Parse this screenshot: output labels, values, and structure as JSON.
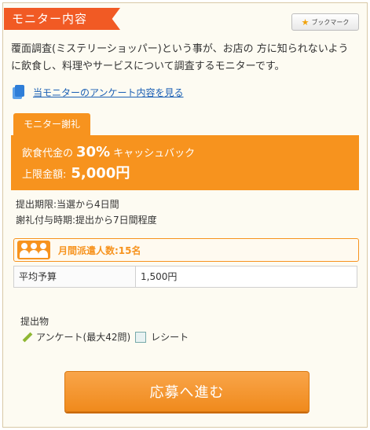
{
  "header": {
    "title": "モニター内容",
    "bookmark_label": "ブックマーク",
    "bookmark_icon": "star-icon"
  },
  "description": "覆面調査(ミステリーショッパー)という事が、お店の 方に知られないように飲食し、料理やサービスについて調査するモニターです。",
  "survey_link": {
    "label": "当モニターのアンケート内容を見る",
    "icon": "document-icon"
  },
  "reward": {
    "tab_label": "モニター謝礼",
    "line1_prefix": "飲食代金の",
    "line1_percent": "30%",
    "line1_suffix": "キャッシュバック",
    "line2_prefix": "上限金額:",
    "line2_amount": "5,000円"
  },
  "period": {
    "deadline": "提出期限:当選から4日間",
    "payment_timing": "謝礼付与時期:提出から7日間程度"
  },
  "dispatch": {
    "label": "月間派遣人数:15名",
    "icon": "people-icon"
  },
  "budget": {
    "label": "平均予算",
    "value": "1,500円"
  },
  "submission": {
    "title": "提出物",
    "items": [
      {
        "label": "アンケート(最大42問)",
        "icon": "pencil-icon"
      },
      {
        "label": "レシート",
        "icon": "receipt-icon"
      }
    ]
  },
  "apply_button": {
    "label": "応募へ進む"
  },
  "colors": {
    "accent": "#f7931e",
    "ribbon": "#f15a24",
    "link": "#1a5fb4"
  }
}
